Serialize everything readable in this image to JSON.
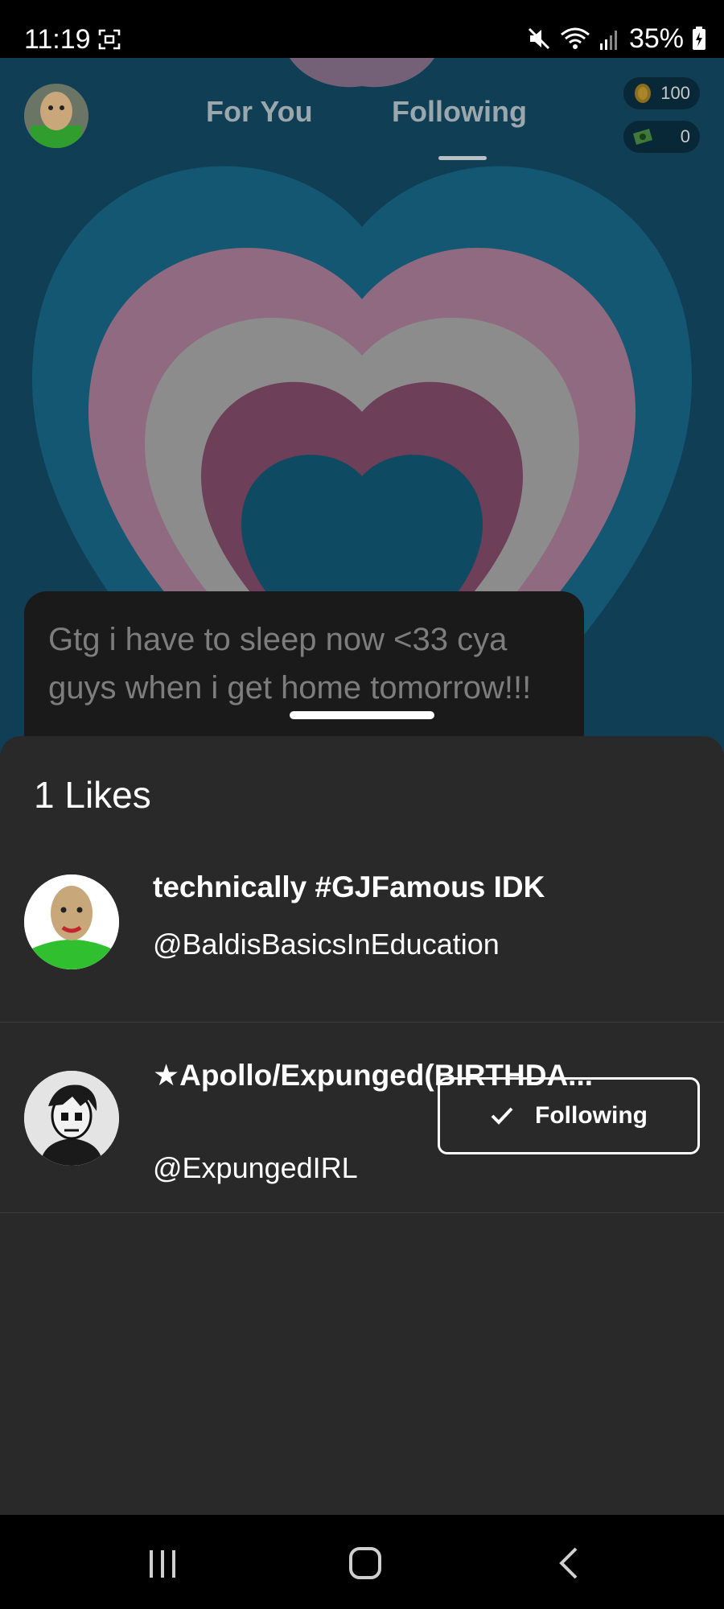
{
  "status_bar": {
    "time": "11:19",
    "battery": "35%"
  },
  "header": {
    "tabs": [
      "For You",
      "Following"
    ],
    "active_tab": "Following",
    "coins": "100",
    "cash": "0"
  },
  "post": {
    "caption": "Gtg i have to sleep now <33 cya guys when i get home tomorrow!!!"
  },
  "likes_sheet": {
    "title": "1 Likes",
    "users": [
      {
        "display_name": "technically #GJFamous IDK",
        "handle": "@BaldisBasicsInEducation"
      },
      {
        "display_name": "★Apollo/Expunged(BIRTHDA...",
        "handle": "@ExpungedIRL",
        "follow_label": "Following"
      }
    ]
  },
  "colors": {
    "sheet_bg": "#292929",
    "feed_blue": "#0f3e55",
    "feed_pink": "#a06a86",
    "feed_gray": "#8a8a8a"
  }
}
